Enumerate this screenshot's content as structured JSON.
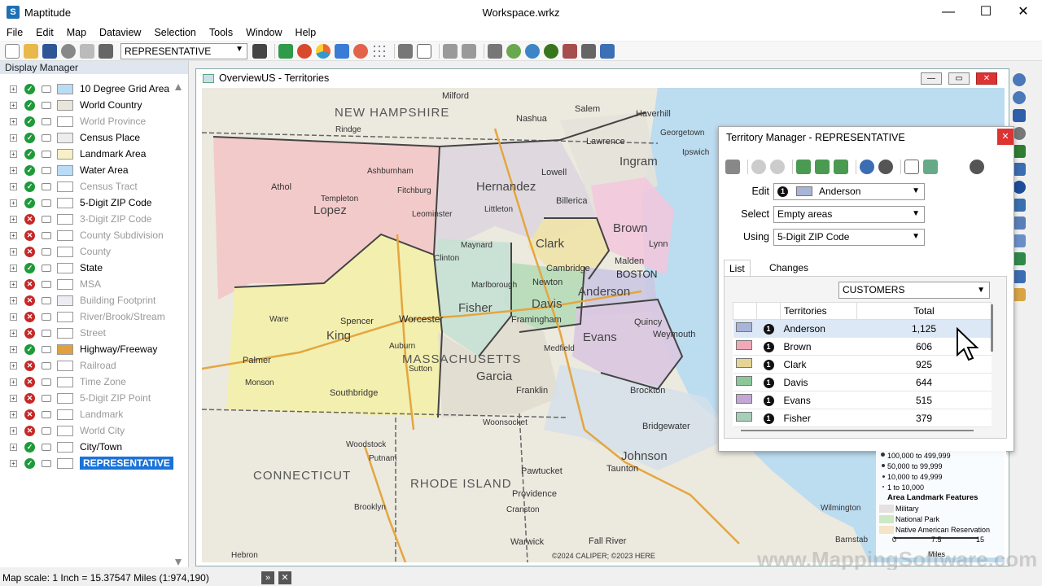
{
  "app": {
    "icon_letter": "S",
    "name": "Maptitude",
    "document": "Workspace.wrkz"
  },
  "menu": [
    "File",
    "Edit",
    "Map",
    "Dataview",
    "Selection",
    "Tools",
    "Window",
    "Help"
  ],
  "toolbar": {
    "layer_value": "REPRESENTATIVE"
  },
  "display_manager": {
    "title": "Display Manager",
    "layers": [
      {
        "name": "10 Degree Grid Area",
        "visible": true,
        "dim": false,
        "color": "#b9dcf4"
      },
      {
        "name": "World Country",
        "visible": true,
        "dim": false,
        "color": "#e8e6da"
      },
      {
        "name": "World Province",
        "visible": true,
        "dim": true,
        "color": "#ffffff"
      },
      {
        "name": "Census Place",
        "visible": true,
        "dim": false,
        "color": "#ededed"
      },
      {
        "name": "Landmark Area",
        "visible": true,
        "dim": false,
        "color": "#f7efc7"
      },
      {
        "name": "Water Area",
        "visible": true,
        "dim": false,
        "color": "#b9dcf4"
      },
      {
        "name": "Census Tract",
        "visible": true,
        "dim": true,
        "color": "#ffffff"
      },
      {
        "name": "5-Digit ZIP Code",
        "visible": true,
        "dim": false,
        "color": "#ffffff"
      },
      {
        "name": "3-Digit ZIP Code",
        "visible": false,
        "dim": true,
        "color": "#ffffff"
      },
      {
        "name": "County Subdivision",
        "visible": false,
        "dim": true,
        "color": "#ffffff"
      },
      {
        "name": "County",
        "visible": false,
        "dim": true,
        "color": "#ffffff"
      },
      {
        "name": "State",
        "visible": true,
        "dim": false,
        "color": "#ffffff"
      },
      {
        "name": "MSA",
        "visible": false,
        "dim": true,
        "color": "#ffffff"
      },
      {
        "name": "Building Footprint",
        "visible": false,
        "dim": true,
        "color": "#ececf2"
      },
      {
        "name": "River/Brook/Stream",
        "visible": false,
        "dim": true,
        "color": "#ffffff"
      },
      {
        "name": "Street",
        "visible": false,
        "dim": true,
        "color": "#ffffff"
      },
      {
        "name": "Highway/Freeway",
        "visible": true,
        "dim": false,
        "color": "#e0a040"
      },
      {
        "name": "Railroad",
        "visible": false,
        "dim": true,
        "color": "#ffffff"
      },
      {
        "name": "Time Zone",
        "visible": false,
        "dim": true,
        "color": "#ffffff"
      },
      {
        "name": "5-Digit ZIP Point",
        "visible": false,
        "dim": true,
        "color": "#ffffff"
      },
      {
        "name": "Landmark",
        "visible": false,
        "dim": true,
        "color": "#ffffff"
      },
      {
        "name": "World City",
        "visible": false,
        "dim": true,
        "color": "#ffffff"
      },
      {
        "name": "City/Town",
        "visible": true,
        "dim": false,
        "color": "#ffffff"
      },
      {
        "name": "REPRESENTATIVE",
        "visible": true,
        "dim": false,
        "color": "#ffffff",
        "selected": true
      }
    ]
  },
  "map_window": {
    "title": "OverviewUS - Territories",
    "copyright": "©2024 CALIPER; ©2023 HERE",
    "territory_labels": [
      "Lopez",
      "Hernandez",
      "Ingram",
      "Brown",
      "Clark",
      "Anderson",
      "Davis",
      "Fisher",
      "King",
      "Evans",
      "Garcia",
      "Johnson"
    ],
    "state_labels": [
      "NEW HAMPSHIRE",
      "MASSACHUSETTS",
      "CONNECTICUT",
      "RHODE ISLAND"
    ],
    "places": [
      "Milford",
      "Salem",
      "Haverhill",
      "Nashua",
      "Georgetown",
      "Rindge",
      "Lawrence",
      "Ipswich",
      "Athol",
      "Ashburnham",
      "Lowell",
      "Billerica",
      "Templeton",
      "Fitchburg",
      "Leominster",
      "Littleton",
      "Lynn",
      "Malden",
      "BOSTON",
      "Maynard",
      "Cambridge",
      "Clinton",
      "Newton",
      "Marlborough",
      "Quincy",
      "Weymouth",
      "Ware",
      "Spencer",
      "Worcester",
      "Framingham",
      "Auburn",
      "Medfield",
      "Palmer",
      "Sutton",
      "Monson",
      "Southbridge",
      "Franklin",
      "Brockton",
      "Woonsocket",
      "Bridgewater",
      "Woodstock",
      "Putnam",
      "Pawtucket",
      "Taunton",
      "Providence",
      "Brooklyn",
      "Cranston",
      "Warwick",
      "Fall River",
      "Hebron",
      "Barnstab",
      "Wilmington"
    ]
  },
  "territory_manager": {
    "title": "Territory Manager - REPRESENTATIVE",
    "edit_label": "Edit",
    "edit_badge": "1",
    "edit_value": "Anderson",
    "edit_color": "#a8b4d8",
    "select_label": "Select",
    "select_value": "Empty areas",
    "using_label": "Using",
    "using_value": "5-Digit ZIP Code",
    "tabs": [
      "List",
      "Changes"
    ],
    "layer_value": "CUSTOMERS",
    "columns": [
      "Territories",
      "Total"
    ],
    "rows": [
      {
        "badge": "1",
        "name": "Anderson",
        "total": "1,125",
        "color": "#a8b4d8"
      },
      {
        "badge": "1",
        "name": "Brown",
        "total": "606",
        "color": "#f1a8b8"
      },
      {
        "badge": "1",
        "name": "Clark",
        "total": "925",
        "color": "#e6d494"
      },
      {
        "badge": "1",
        "name": "Davis",
        "total": "644",
        "color": "#8cc79a"
      },
      {
        "badge": "1",
        "name": "Evans",
        "total": "515",
        "color": "#c3a7d6"
      },
      {
        "badge": "1",
        "name": "Fisher",
        "total": "379",
        "color": "#a6cfb8"
      }
    ]
  },
  "legend": {
    "population_items": [
      "100,000 to 499,999",
      "50,000 to 99,999",
      "10,000 to 49,999",
      "1 to 10,000"
    ],
    "section_title": "Area Landmark Features",
    "features": [
      {
        "name": "Military",
        "color": "#e6e1e1"
      },
      {
        "name": "National Park",
        "color": "#cde8c4"
      },
      {
        "name": "Native American Reservation",
        "color": "#f4e4c8"
      }
    ],
    "scale_ticks": [
      "0",
      "7.5",
      "15"
    ],
    "scale_unit": "Miles"
  },
  "watermark": "www.MappingSoftware.com",
  "status": {
    "scale_text": "Map scale: 1 Inch = 15.37547 Miles (1:974,190)"
  }
}
